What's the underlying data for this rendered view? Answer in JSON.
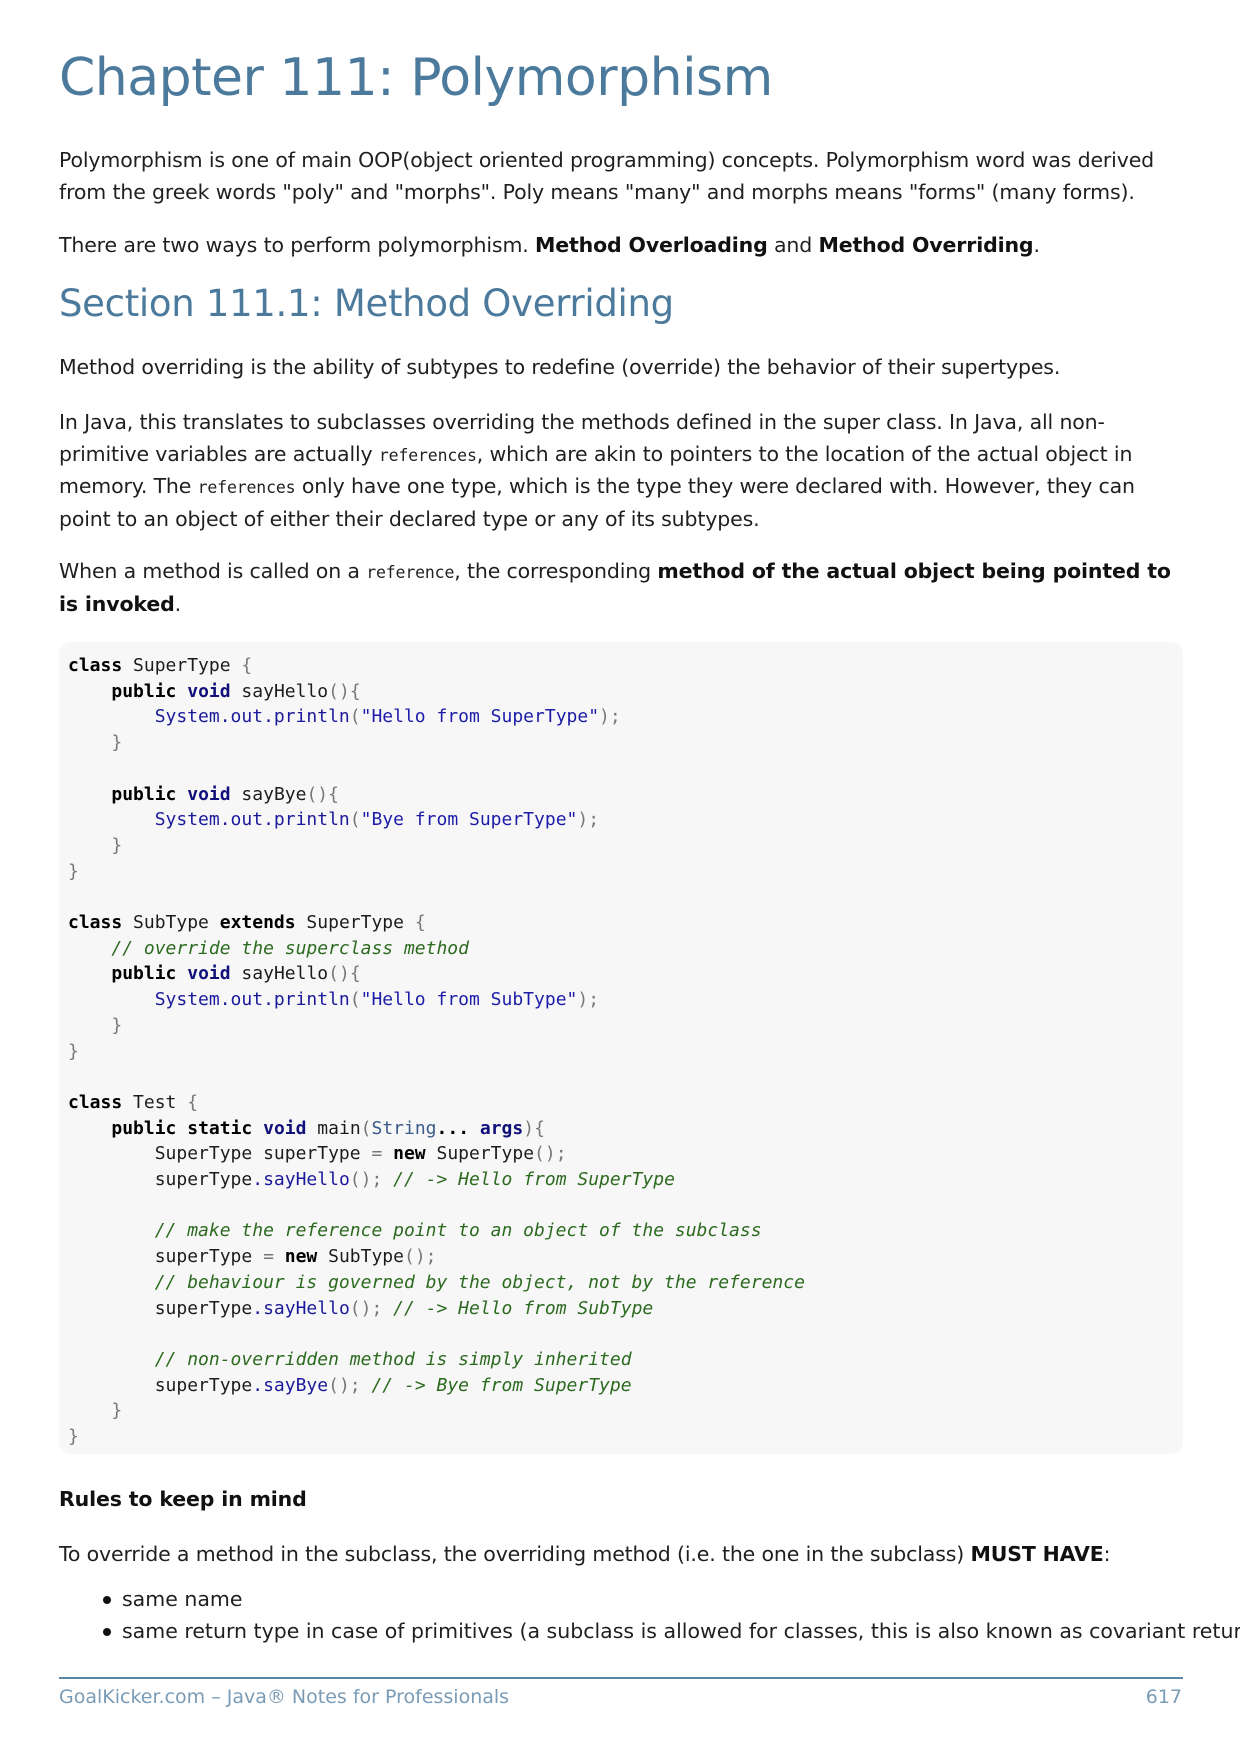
{
  "chapter_title": "Chapter 111: Polymorphism",
  "intro": {
    "p1": "Polymorphism is one of main OOP(object oriented programming) concepts. Polymorphism word was derived from the greek words \"poly\" and \"morphs\". Poly means \"many\" and morphs means \"forms\" (many forms).",
    "p2_start": "There are two ways to perform polymorphism. ",
    "p2_bold1": "Method Overloading",
    "p2_mid": " and ",
    "p2_bold2": "Method Overriding",
    "p2_end": "."
  },
  "section_title": "Section 111.1: Method Overriding",
  "section": {
    "p1": "Method overriding is the ability of subtypes to redefine (override) the behavior of their supertypes.",
    "p2_a": "In Java, this translates to subclasses overriding the methods defined in the super class. In Java, all non-primitive variables are actually ",
    "p2_code1": "references",
    "p2_b": ", which are akin to pointers to the location of the actual object in memory. The ",
    "p2_code2": "references",
    "p2_c": " only have one type, which is the type they were declared with. However, they can point to an object of either their declared type or any of its subtypes.",
    "p3_a": "When a method is called on a ",
    "p3_code": "reference",
    "p3_b": ", the corresponding ",
    "p3_bold": "method of the actual object being pointed to is invoked",
    "p3_c": "."
  },
  "code": {
    "l1_k": "class",
    "l1_n": " SuperType ",
    "l1_p": "{",
    "l2_k": "public",
    "l2_kt": "void",
    "l2_n": " sayHello",
    "l2_p": "(){",
    "l3_a": "System.out.println",
    "l3_p1": "(",
    "l3_s": "\"Hello from SuperType\"",
    "l3_p2": ");",
    "l4_p": "}",
    "l6_k": "public",
    "l6_kt": "void",
    "l6_n": " sayBye",
    "l6_p": "(){",
    "l7_a": "System.out.println",
    "l7_p1": "(",
    "l7_s": "\"Bye from SuperType\"",
    "l7_p2": ");",
    "l8_p": "}",
    "l9_p": "}",
    "l11_k": "class",
    "l11_n": " SubType ",
    "l11_k2": "extends",
    "l11_n2": " SuperType ",
    "l11_p": "{",
    "l12_c": "// override the superclass method",
    "l13_k": "public",
    "l13_kt": "void",
    "l13_n": " sayHello",
    "l13_p": "(){",
    "l14_a": "System.out.println",
    "l14_p1": "(",
    "l14_s": "\"Hello from SubType\"",
    "l14_p2": ");",
    "l15_p": "}",
    "l16_p": "}",
    "l18_k": "class",
    "l18_n": " Test ",
    "l18_p": "{",
    "l19_k1": "public",
    "l19_k2": "static",
    "l19_kt": "void",
    "l19_n": " main",
    "l19_p1": "(",
    "l19_t": "String",
    "l19_dots": "...",
    "l19_a": " args",
    "l19_p2": "){",
    "l20_n1": "SuperType superType ",
    "l20_p1": "=",
    "l20_k": " new",
    "l20_n2": " SuperType",
    "l20_p2": "();",
    "l21_n": "superType",
    "l21_m": ".sayHello",
    "l21_p": "(); ",
    "l21_c": "// -> Hello from SuperType",
    "l23_c": "// make the reference point to an object of the subclass",
    "l24_n1": "superType ",
    "l24_p1": "=",
    "l24_k": " new",
    "l24_n2": " SubType",
    "l24_p2": "();",
    "l25_c": "// behaviour is governed by the object, not by the reference",
    "l26_n": "superType",
    "l26_m": ".sayHello",
    "l26_p": "(); ",
    "l26_c": "// -> Hello from SubType",
    "l28_c": "// non-overridden method is simply inherited",
    "l29_n": "superType",
    "l29_m": ".sayBye",
    "l29_p": "(); ",
    "l29_c": "// -> Bye from SuperType",
    "l30_p": "}",
    "l31_p": "}"
  },
  "rules_heading": "Rules to keep in mind",
  "rules_intro_a": "To override a method in the subclass, the overriding method (i.e. the one in the subclass) ",
  "rules_intro_bold": "MUST HAVE",
  "rules_intro_c": ":",
  "rules": [
    "same name",
    "same return type in case of primitives (a subclass is allowed for classes, this is also known as covariant return"
  ],
  "footer": {
    "left": "GoalKicker.com – Java® Notes for Professionals",
    "page_number": "617"
  }
}
